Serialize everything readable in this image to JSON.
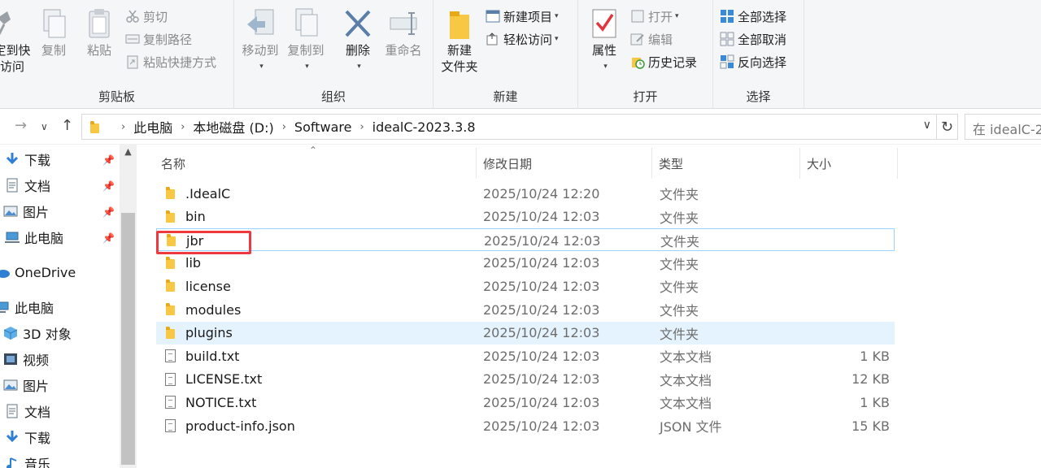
{
  "ribbon": {
    "clipboard": {
      "pin_quick_access": "固定到快速\n访问",
      "pin_line1": "定到快",
      "pin_line2": "访问",
      "copy": "复制",
      "paste": "粘贴",
      "cut": "剪切",
      "copy_path": "复制路径",
      "paste_shortcut": "粘贴快捷方式",
      "label": "剪贴板"
    },
    "organize": {
      "move_to": "移动到",
      "copy_to": "复制到",
      "delete": "删除",
      "rename": "重命名",
      "label": "组织"
    },
    "new": {
      "new_folder_line1": "新建",
      "new_folder_line2": "文件夹",
      "new_item": "新建项目",
      "easy_access": "轻松访问",
      "label": "新建"
    },
    "open": {
      "properties": "属性",
      "open": "打开",
      "edit": "编辑",
      "history": "历史记录",
      "label": "打开"
    },
    "select": {
      "select_all": "全部选择",
      "select_none": "全部取消",
      "invert": "反向选择",
      "label": "选择"
    }
  },
  "address": {
    "crumbs": [
      "此电脑",
      "本地磁盘 (D:)",
      "Software",
      "idealC-2023.3.8"
    ],
    "search_placeholder": "在 idealC-2"
  },
  "nav": {
    "items": [
      {
        "label": "下载",
        "icon": "download-arrow-icon",
        "pinned": true
      },
      {
        "label": "文档",
        "icon": "documents-icon",
        "pinned": true
      },
      {
        "label": "图片",
        "icon": "pictures-icon",
        "pinned": true
      },
      {
        "label": "此电脑",
        "icon": "computer-icon",
        "pinned": true
      },
      {
        "label": "OneDrive",
        "icon": "cloud-icon",
        "pinned": false
      },
      {
        "label": "此电脑",
        "icon": "computer-icon",
        "pinned": false
      },
      {
        "label": "3D 对象",
        "icon": "cube-3d-icon",
        "pinned": false
      },
      {
        "label": "视频",
        "icon": "video-icon",
        "pinned": false
      },
      {
        "label": "图片",
        "icon": "pictures-icon",
        "pinned": false
      },
      {
        "label": "文档",
        "icon": "documents-icon",
        "pinned": false
      },
      {
        "label": "下载",
        "icon": "download-arrow-icon",
        "pinned": false
      },
      {
        "label": "音乐",
        "icon": "music-icon",
        "pinned": false
      }
    ]
  },
  "columns": {
    "name": "名称",
    "date": "修改日期",
    "type": "类型",
    "size": "大小"
  },
  "files": [
    {
      "name": ".IdealC",
      "date": "2025/10/24 12:20",
      "type": "文件夹",
      "size": "",
      "kind": "folder"
    },
    {
      "name": "bin",
      "date": "2025/10/24 12:03",
      "type": "文件夹",
      "size": "",
      "kind": "folder"
    },
    {
      "name": "jbr",
      "date": "2025/10/24 12:03",
      "type": "文件夹",
      "size": "",
      "kind": "folder"
    },
    {
      "name": "lib",
      "date": "2025/10/24 12:03",
      "type": "文件夹",
      "size": "",
      "kind": "folder"
    },
    {
      "name": "license",
      "date": "2025/10/24 12:03",
      "type": "文件夹",
      "size": "",
      "kind": "folder"
    },
    {
      "name": "modules",
      "date": "2025/10/24 12:03",
      "type": "文件夹",
      "size": "",
      "kind": "folder"
    },
    {
      "name": "plugins",
      "date": "2025/10/24 12:03",
      "type": "文件夹",
      "size": "",
      "kind": "folder"
    },
    {
      "name": "build.txt",
      "date": "2025/10/24 12:03",
      "type": "文本文档",
      "size": "1 KB",
      "kind": "txt"
    },
    {
      "name": "LICENSE.txt",
      "date": "2025/10/24 12:03",
      "type": "文本文档",
      "size": "12 KB",
      "kind": "txt"
    },
    {
      "name": "NOTICE.txt",
      "date": "2025/10/24 12:03",
      "type": "文本文档",
      "size": "1 KB",
      "kind": "txt"
    },
    {
      "name": "product-info.json",
      "date": "2025/10/24 12:03",
      "type": "JSON 文件",
      "size": "15 KB",
      "kind": "json"
    }
  ],
  "colors": {
    "accent_blue": "#0078d7",
    "folder_yellow": "#f8c744",
    "highlight_red": "#f0393f",
    "hover_row": "#e5f3ff"
  }
}
